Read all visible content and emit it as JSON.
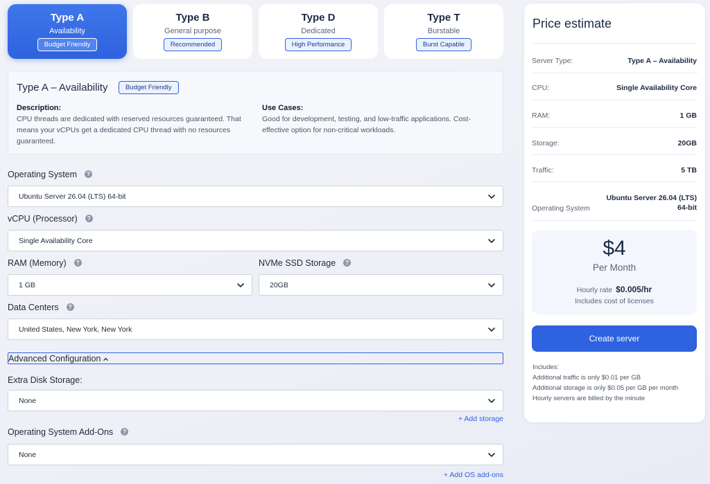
{
  "types": [
    {
      "title": "Type A",
      "subtitle": "Availability",
      "badge": "Budget Friendly",
      "active": true
    },
    {
      "title": "Type B",
      "subtitle": "General purpose",
      "badge": "Recommended",
      "active": false
    },
    {
      "title": "Type D",
      "subtitle": "Dedicated",
      "badge": "High Performance",
      "active": false
    },
    {
      "title": "Type T",
      "subtitle": "Burstable",
      "badge": "Burst Capable",
      "active": false
    }
  ],
  "description": {
    "title": "Type A – Availability",
    "badge": "Budget Friendly",
    "desc_heading": "Description:",
    "desc_text": "CPU threads are dedicated with reserved resources guaranteed. That means your vCPUs get a dedicated CPU thread with no resources guaranteed.",
    "use_heading": "Use Cases:",
    "use_text": "Good for development, testing, and low-traffic applications. Cost-effective option for non-critical workloads."
  },
  "form": {
    "help_glyph": "?",
    "os": {
      "label": "Operating System",
      "value": "Ubuntu Server 26.04 (LTS) 64-bit"
    },
    "vcpu": {
      "label": "vCPU (Processor)",
      "value": "Single Availability Core"
    },
    "ram": {
      "label": "RAM (Memory)",
      "value": "1 GB"
    },
    "storage": {
      "label": "NVMe SSD Storage",
      "value": "20GB"
    },
    "datacenter": {
      "label": "Data Centers",
      "value": "United States, New York, New York"
    },
    "advanced": {
      "label": "Advanced Configuration"
    },
    "extra_disk": {
      "label": "Extra Disk Storage:",
      "value": "None",
      "add_link": "+ Add storage"
    },
    "os_addons": {
      "label": "Operating System Add-Ons",
      "value": "None",
      "add_link": "+ Add OS add-ons"
    }
  },
  "estimate": {
    "title": "Price estimate",
    "rows": [
      {
        "label": "Server Type:",
        "value": "Type A – Availability"
      },
      {
        "label": "CPU:",
        "value": "Single Availability Core"
      },
      {
        "label": "RAM:",
        "value": "1 GB"
      },
      {
        "label": "Storage:",
        "value": "20GB"
      },
      {
        "label": "Traffic:",
        "value": "5 TB"
      }
    ],
    "os_row": {
      "label": "Operating System",
      "value_line1": "Ubuntu Server 26.04 (LTS)",
      "value_line2": "64-bit"
    },
    "price": "$4",
    "period": "Per Month",
    "hourly_label": "Hourly rate",
    "hourly_value": "$0.005/hr",
    "licenses": "Includes cost of licenses",
    "create_button": "Create server",
    "includes": {
      "heading": "Includes:",
      "items": [
        "Additional traffic is only $0.01 per GB",
        "Additional storage is only $0.05 per GB per month",
        "Hourly servers are billed by the minute"
      ]
    }
  },
  "colors": {
    "accent": "#2f62de",
    "background": "#eef0f7",
    "card": "#ffffff"
  }
}
